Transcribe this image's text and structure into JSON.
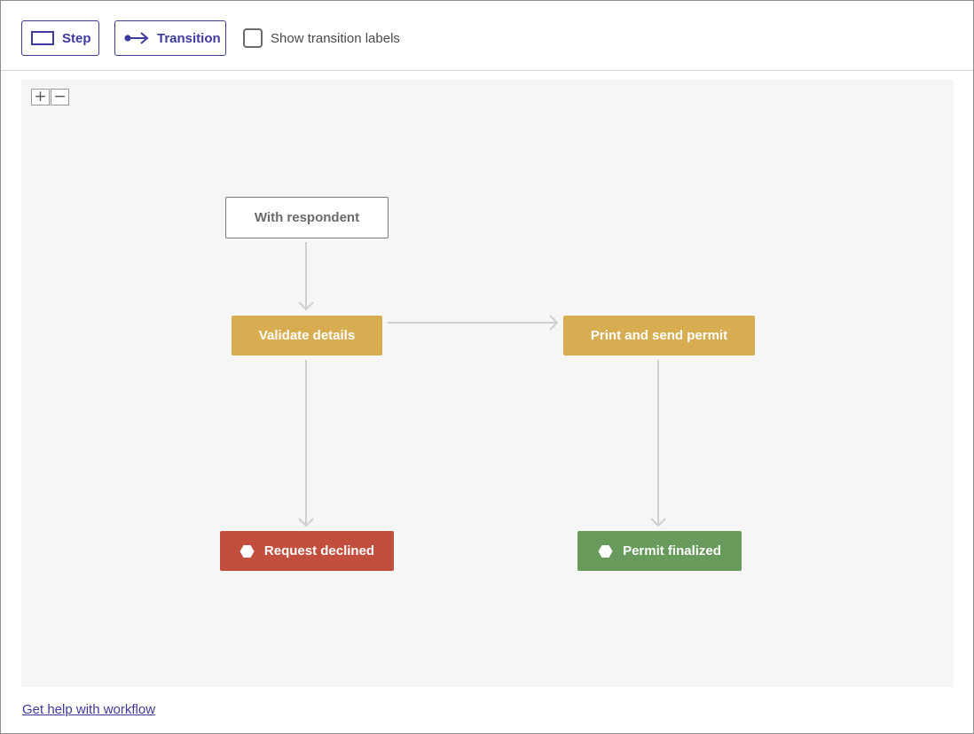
{
  "toolbar": {
    "step_label": "Step",
    "transition_label": "Transition",
    "show_labels_text": "Show transition labels",
    "show_labels_checked": false
  },
  "zoom": {
    "in_symbol": "+",
    "out_symbol": "−"
  },
  "workflow": {
    "nodes": {
      "with_respondent": "With respondent",
      "validate_details": "Validate details",
      "print_send_permit": "Print and send permit",
      "request_declined": "Request declined",
      "permit_finalized": "Permit finalized"
    },
    "colors": {
      "step": "#d8ad51",
      "declined": "#c24f3e",
      "final": "#679a5b",
      "edge": "#cfcfcf",
      "accent": "#3d3a9e"
    }
  },
  "footer": {
    "help_link": "Get help with workflow"
  },
  "icons": {
    "step": "rectangle-icon",
    "transition": "arrow-right-dot-icon",
    "end_state": "hexagon-icon"
  }
}
